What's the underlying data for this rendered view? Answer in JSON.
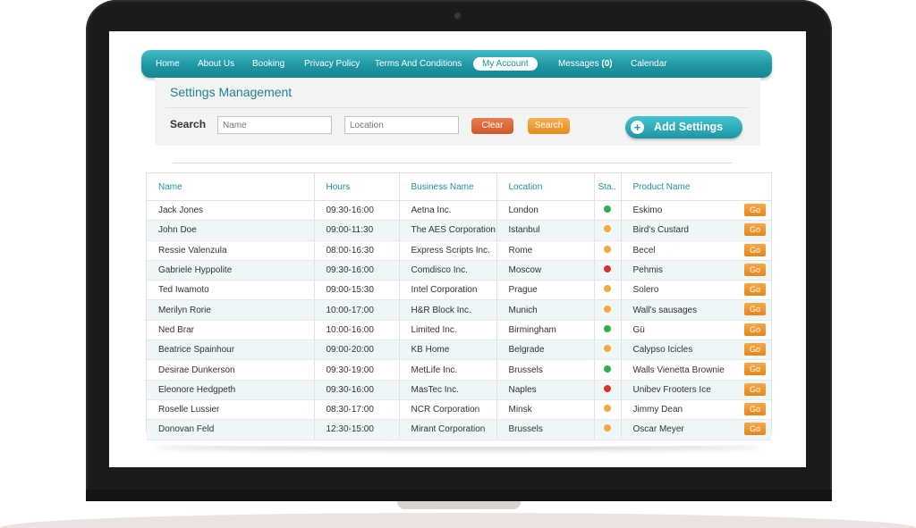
{
  "nav": {
    "items": [
      "Home",
      "About Us",
      "Booking",
      "Privacy Policy",
      "Terms And Conditions",
      "My Account",
      "Messages",
      "Calendar"
    ],
    "messages_count": "(0)",
    "active": "My Account"
  },
  "panel": {
    "title": "Settings Management",
    "search_label": "Search",
    "name_placeholder": "Name",
    "location_placeholder": "Location",
    "clear_label": "Clear",
    "search_button_label": "Search",
    "add_label": "Add Settings"
  },
  "table": {
    "headers": [
      "Name",
      "Hours",
      "Business Name",
      "Location",
      "Sta..",
      "Product Name"
    ],
    "go_label": "Go",
    "status_colors": {
      "green": "#2db14c",
      "orange": "#f4a93b",
      "red": "#d8322e"
    },
    "rows": [
      {
        "name": "Jack Jones",
        "hours": "09:30-16:00",
        "business": "Aetna Inc.",
        "location": "London",
        "status": "green",
        "product": "Eskimo"
      },
      {
        "name": "John Doe",
        "hours": "09:00-11:30",
        "business": "The AES Corporation",
        "location": "Istanbul",
        "status": "orange",
        "product": "Bird's Custard"
      },
      {
        "name": "Ressie Valenzula",
        "hours": "08:00-16:30",
        "business": "Express Scripts Inc.",
        "location": "Rome",
        "status": "orange",
        "product": "Becel"
      },
      {
        "name": "Gabriele Hyppolite",
        "hours": "09:30-16:00",
        "business": "Comdisco Inc.",
        "location": "Moscow",
        "status": "red",
        "product": "Pehmis"
      },
      {
        "name": "Ted Iwamoto",
        "hours": "09:00-15:30",
        "business": "Intel Corporation",
        "location": "Prague",
        "status": "orange",
        "product": "Solero"
      },
      {
        "name": "Merilyn Rorie",
        "hours": "10:00-17:00",
        "business": "H&R Block Inc.",
        "location": "Munich",
        "status": "orange",
        "product": "Wall's sausages"
      },
      {
        "name": "Ned Brar",
        "hours": "10:00-16:00",
        "business": "Limited Inc.",
        "location": "Birmingham",
        "status": "green",
        "product": "Gü"
      },
      {
        "name": "Beatrice Spainhour",
        "hours": "09:00-20:00",
        "business": "KB Home",
        "location": "Belgrade",
        "status": "orange",
        "product": "Calypso Icicles"
      },
      {
        "name": "Desirae Dunkerson",
        "hours": "09:30-19:00",
        "business": "MetLife Inc.",
        "location": "Brussels",
        "status": "green",
        "product": "Walls Vienetta Brownie"
      },
      {
        "name": "Eleonore Hedgpeth",
        "hours": "09:30-16:00",
        "business": "MasTec Inc.",
        "location": "Naples",
        "status": "red",
        "product": "Unibev Frooters Ice"
      },
      {
        "name": "Roselle Lussier",
        "hours": "08:30-17:00",
        "business": "NCR Corporation",
        "location": "Minsk",
        "status": "orange",
        "product": "Jimmy Dean"
      },
      {
        "name": "Donovan Feld",
        "hours": "12:30-15:00",
        "business": "Mirant Corporation",
        "location": "Brussels",
        "status": "orange",
        "product": "Oscar Meyer"
      }
    ]
  }
}
